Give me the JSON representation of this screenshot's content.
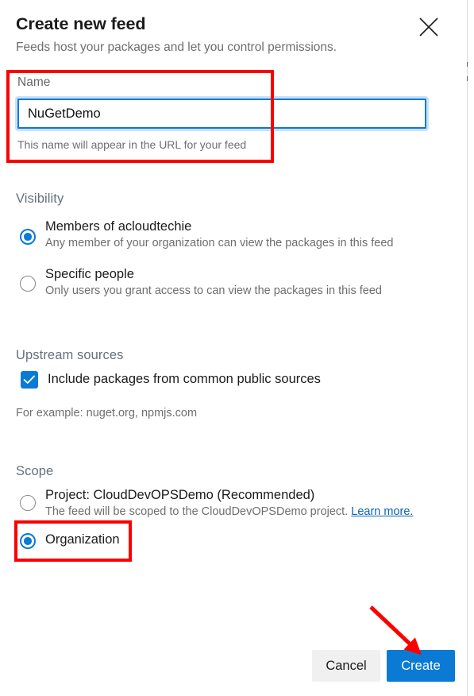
{
  "dialog": {
    "title": "Create new feed",
    "subtitle": "Feeds host your packages and let you control permissions.",
    "close_icon": "close-icon"
  },
  "name_field": {
    "label": "Name",
    "value": "NuGetDemo",
    "placeholder": "",
    "hint": "This name will appear in the URL for your feed"
  },
  "visibility": {
    "heading": "Visibility",
    "options": [
      {
        "title": "Members of acloudtechie",
        "description": "Any member of your organization can view the packages in this feed",
        "selected": true
      },
      {
        "title": "Specific people",
        "description": "Only users you grant access to can view the packages in this feed",
        "selected": false
      }
    ]
  },
  "upstream": {
    "heading": "Upstream sources",
    "checkbox_label": "Include packages from common public sources",
    "checked": true,
    "example": "For example: nuget.org, npmjs.com"
  },
  "scope": {
    "heading": "Scope",
    "options": [
      {
        "title": "Project: CloudDevOPSDemo (Recommended)",
        "description": "The feed will be scoped to the CloudDevOPSDemo project.",
        "link": "Learn more.",
        "selected": false
      },
      {
        "title": "Organization",
        "description": "",
        "selected": true
      }
    ]
  },
  "footer": {
    "cancel_label": "Cancel",
    "create_label": "Create"
  },
  "colors": {
    "accent_blue": "#0a7ad4",
    "link_blue": "#0a63b7",
    "annotation_red": "#fc0000",
    "heading_gray": "#64707d",
    "body_gray": "#6e6e6e"
  }
}
